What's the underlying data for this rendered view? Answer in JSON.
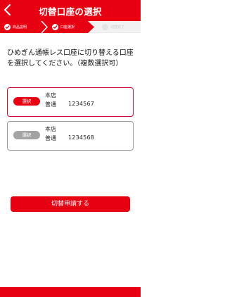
{
  "header": {
    "title": "切替口座の選択",
    "back_icon": "chevron-left-icon"
  },
  "steps": [
    {
      "label": "商品説明",
      "state": "done"
    },
    {
      "label": "口座選択",
      "state": "current"
    },
    {
      "label": "切替完了",
      "state": "todo"
    }
  ],
  "instruction": "ひめぎん通帳レス口座に切り替える口座を選択してください。（複数選択可）",
  "accounts": [
    {
      "select_label": "選択",
      "selected": true,
      "branch": "本店",
      "type": "普通",
      "number": "1234567"
    },
    {
      "select_label": "選択",
      "selected": false,
      "branch": "本店",
      "type": "普通",
      "number": "1234568"
    }
  ],
  "submit_label": "切替申請する",
  "colors": {
    "brand": "#e60012",
    "step_bg": "#f2f2f2",
    "inactive": "#a3a3a3"
  }
}
